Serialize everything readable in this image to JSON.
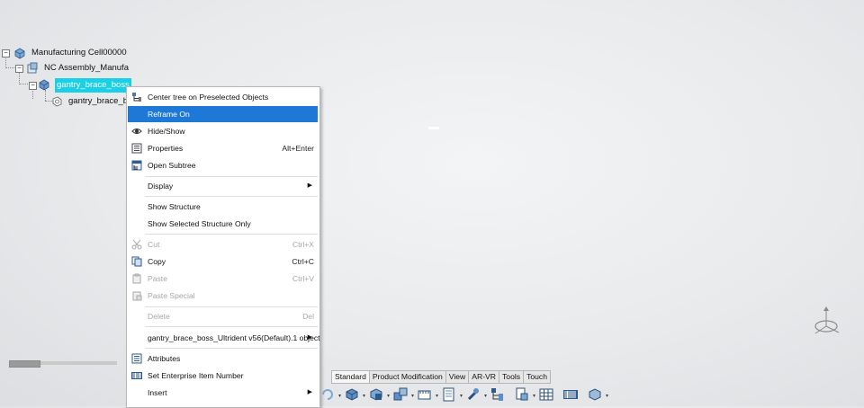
{
  "tree": {
    "nodes": [
      {
        "label": "Manufacturing Cell00000",
        "icon": "manufacturing-cell-icon",
        "expander": "−"
      },
      {
        "label": "NC Assembly_Manufa",
        "icon": "assembly-icon",
        "expander": "−"
      },
      {
        "label": "gantry_brace_boss",
        "icon": "product-icon",
        "expander": "−",
        "selected": true
      },
      {
        "label": "gantry_brace_bo",
        "icon": "part-icon"
      }
    ]
  },
  "context_menu": {
    "items": [
      {
        "label": "Center tree on Preselected Objects",
        "icon": "center-tree-icon"
      },
      {
        "label": "Reframe On",
        "highlighted": true
      },
      {
        "label": "Hide/Show",
        "icon": "eye-icon"
      },
      {
        "label": "Properties",
        "icon": "properties-icon",
        "shortcut": "Alt+Enter"
      },
      {
        "label": "Open Subtree",
        "icon": "open-subtree-icon"
      },
      {
        "label": "Display",
        "submenu": true
      },
      {
        "label": "Show Structure"
      },
      {
        "label": "Show Selected Structure Only"
      },
      {
        "label": "Cut",
        "icon": "scissors-icon",
        "shortcut": "Ctrl+X",
        "disabled": true
      },
      {
        "label": "Copy",
        "icon": "copy-icon",
        "shortcut": "Ctrl+C"
      },
      {
        "label": "Paste",
        "icon": "paste-icon",
        "shortcut": "Ctrl+V",
        "disabled": true
      },
      {
        "label": "Paste Special",
        "icon": "paste-special-icon",
        "disabled": true
      },
      {
        "label": "Delete",
        "shortcut": "Del",
        "disabled": true
      },
      {
        "label": "gantry_brace_boss_Ultrident v56(Default).1 object",
        "submenu": true
      },
      {
        "label": "Attributes",
        "icon": "attributes-icon"
      },
      {
        "label": "Set Enterprise Item Number",
        "icon": "barcode-icon"
      },
      {
        "label": "Insert",
        "submenu": true
      }
    ]
  },
  "tabs": [
    "Standard",
    "Product Modification",
    "View",
    "AR-VR",
    "Tools",
    "Touch"
  ],
  "toolbar": {
    "icons": [
      "rotate-icon",
      "cube-icon",
      "cube-view-icon",
      "assembly-tool-icon",
      "measure-icon",
      "list-icon",
      "wrench-icon",
      "tree-branch-icon",
      "structure-icon",
      "grid-icon",
      "barcode-tool-icon",
      "box-tool-icon"
    ]
  },
  "colors": {
    "selection": "#1ad0e6",
    "menu_highlight": "#1e78d6"
  }
}
